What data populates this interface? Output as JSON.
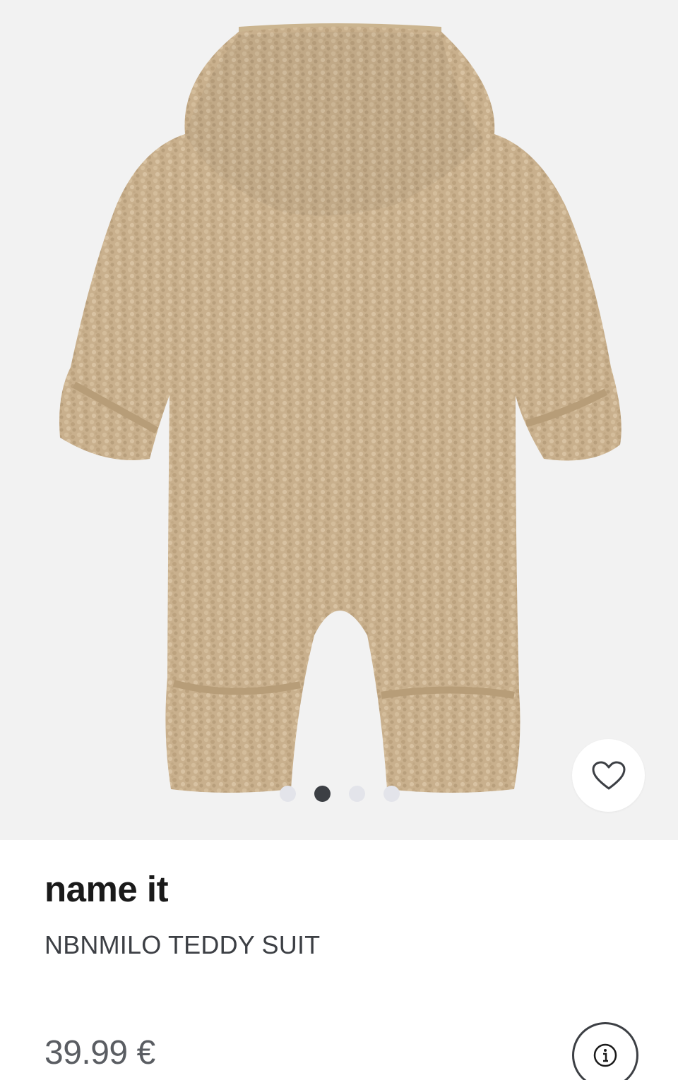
{
  "product": {
    "brand": "name it",
    "name": "NBNMILO TEDDY SUIT",
    "price": "39.99 €"
  },
  "gallery": {
    "image_count": 4,
    "active_index": 1
  },
  "icons": {
    "wishlist": "heart-icon",
    "info": "info-icon"
  },
  "colors": {
    "gallery_background": "#f2f2f2",
    "fabric": "#c9b08d",
    "dot_active": "#3c3f44",
    "dot_inactive": "#e3e4ea"
  }
}
